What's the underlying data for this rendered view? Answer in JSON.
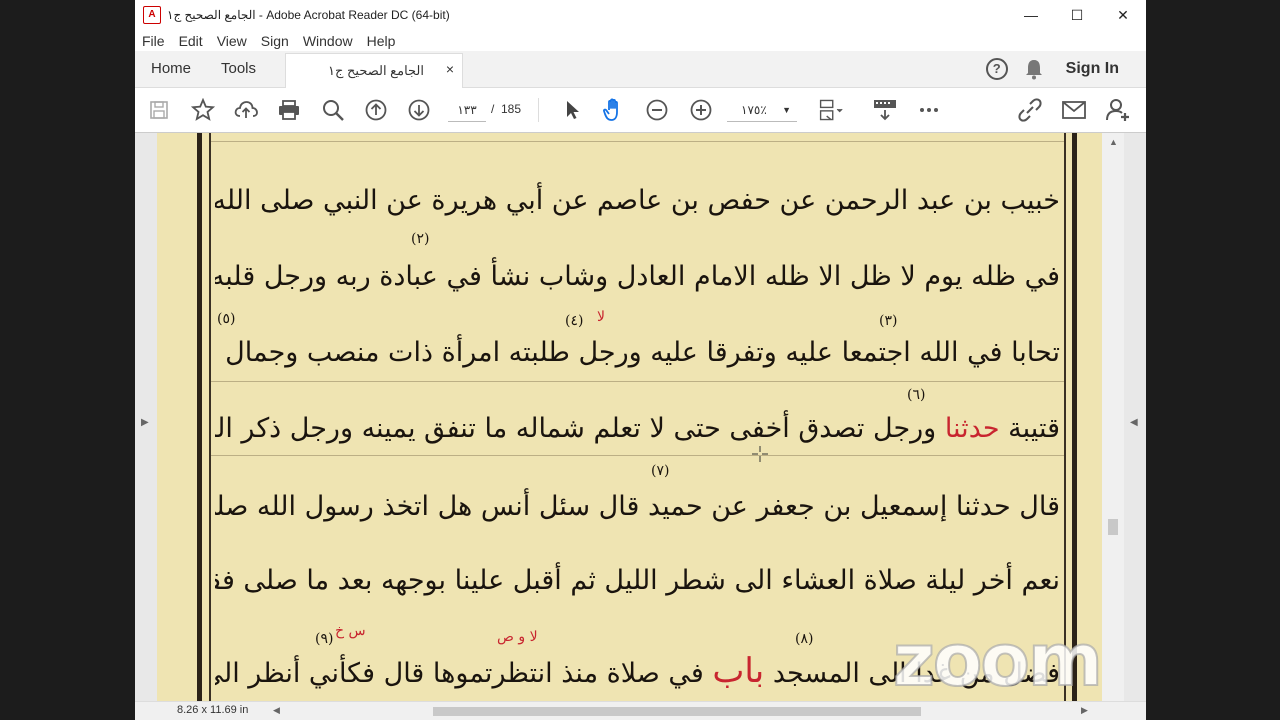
{
  "window": {
    "title": "الجامع الصحيح ج١ - Adobe Acrobat Reader DC (64-bit)",
    "minimize": "—",
    "maximize": "☐",
    "close": "✕"
  },
  "menu": [
    "File",
    "Edit",
    "View",
    "Sign",
    "Window",
    "Help"
  ],
  "tabs": {
    "home": "Home",
    "tools": "Tools",
    "document": "الجامع الصحيح ج١",
    "document_close": "×",
    "sign_in": "Sign In"
  },
  "toolbar": {
    "page_current": "١٣٣",
    "page_sep": "/",
    "page_total": "185",
    "zoom": "١٧٥٪",
    "icons": [
      "save-icon",
      "star-icon",
      "upload-icon",
      "print-icon",
      "search-icon",
      "page-up-icon",
      "page-down-icon",
      "select-icon",
      "hand-icon",
      "zoom-out-icon",
      "zoom-in-icon",
      "fit-page-icon",
      "scroll-mode-icon",
      "more-icon",
      "link-icon",
      "mail-icon",
      "share-user-icon"
    ]
  },
  "status": {
    "page_size": "8.26 x 11.69 in"
  },
  "document": {
    "lines": [
      "خبيب بن عبد الرحمن عن حفص بن عاصم عن أبي هريرة عن النبي صلى الله عليه وسلم قال سبعة يظلهم الله",
      "في ظله يوم لا ظل الا ظله الامام العادل وشاب نشأ في عبادة ربه ورجل قلبه معلق في المساجد ورجلان",
      "تحابا في الله اجتمعا عليه وتفرقا عليه ورجل طلبته امرأة ذات منصب وجمال فقال إني أخاف الله",
      "ورجل تصدق أخفى حتى لا تعلم شماله ما تنفق يمينه ورجل ذكر الله خاليا ففاضت عيناه",
      "قال حدثنا إسمعيل بن جعفر عن حميد قال سئل أنس هل اتخذ رسول الله صلى الله عليه وسلم خاتما فقال",
      "نعم أخر ليلة صلاة العشاء الى شطر الليل ثم أقبل علينا بوجهه بعد ما صلى فقال صلى الناس ورقدوا ولم تزالوا",
      "في صلاة منذ انتظرتموها قال فكأني أنظر الى وبيص خاتمه"
    ],
    "red_haddathana": "حدثنا",
    "qutayba": "قتيبة",
    "bab": "باب",
    "line7_end": "فضل من غدا الى المسجد",
    "notes": [
      "(٢)",
      "(٣)",
      "(٤)",
      "(٥)",
      "(٦)",
      "(٧)",
      "(٨)",
      "(٩)"
    ],
    "red_notes": [
      "لا",
      "لا و ص",
      "س خ"
    ]
  },
  "overlay": {
    "zoom_logo": "zoom"
  }
}
